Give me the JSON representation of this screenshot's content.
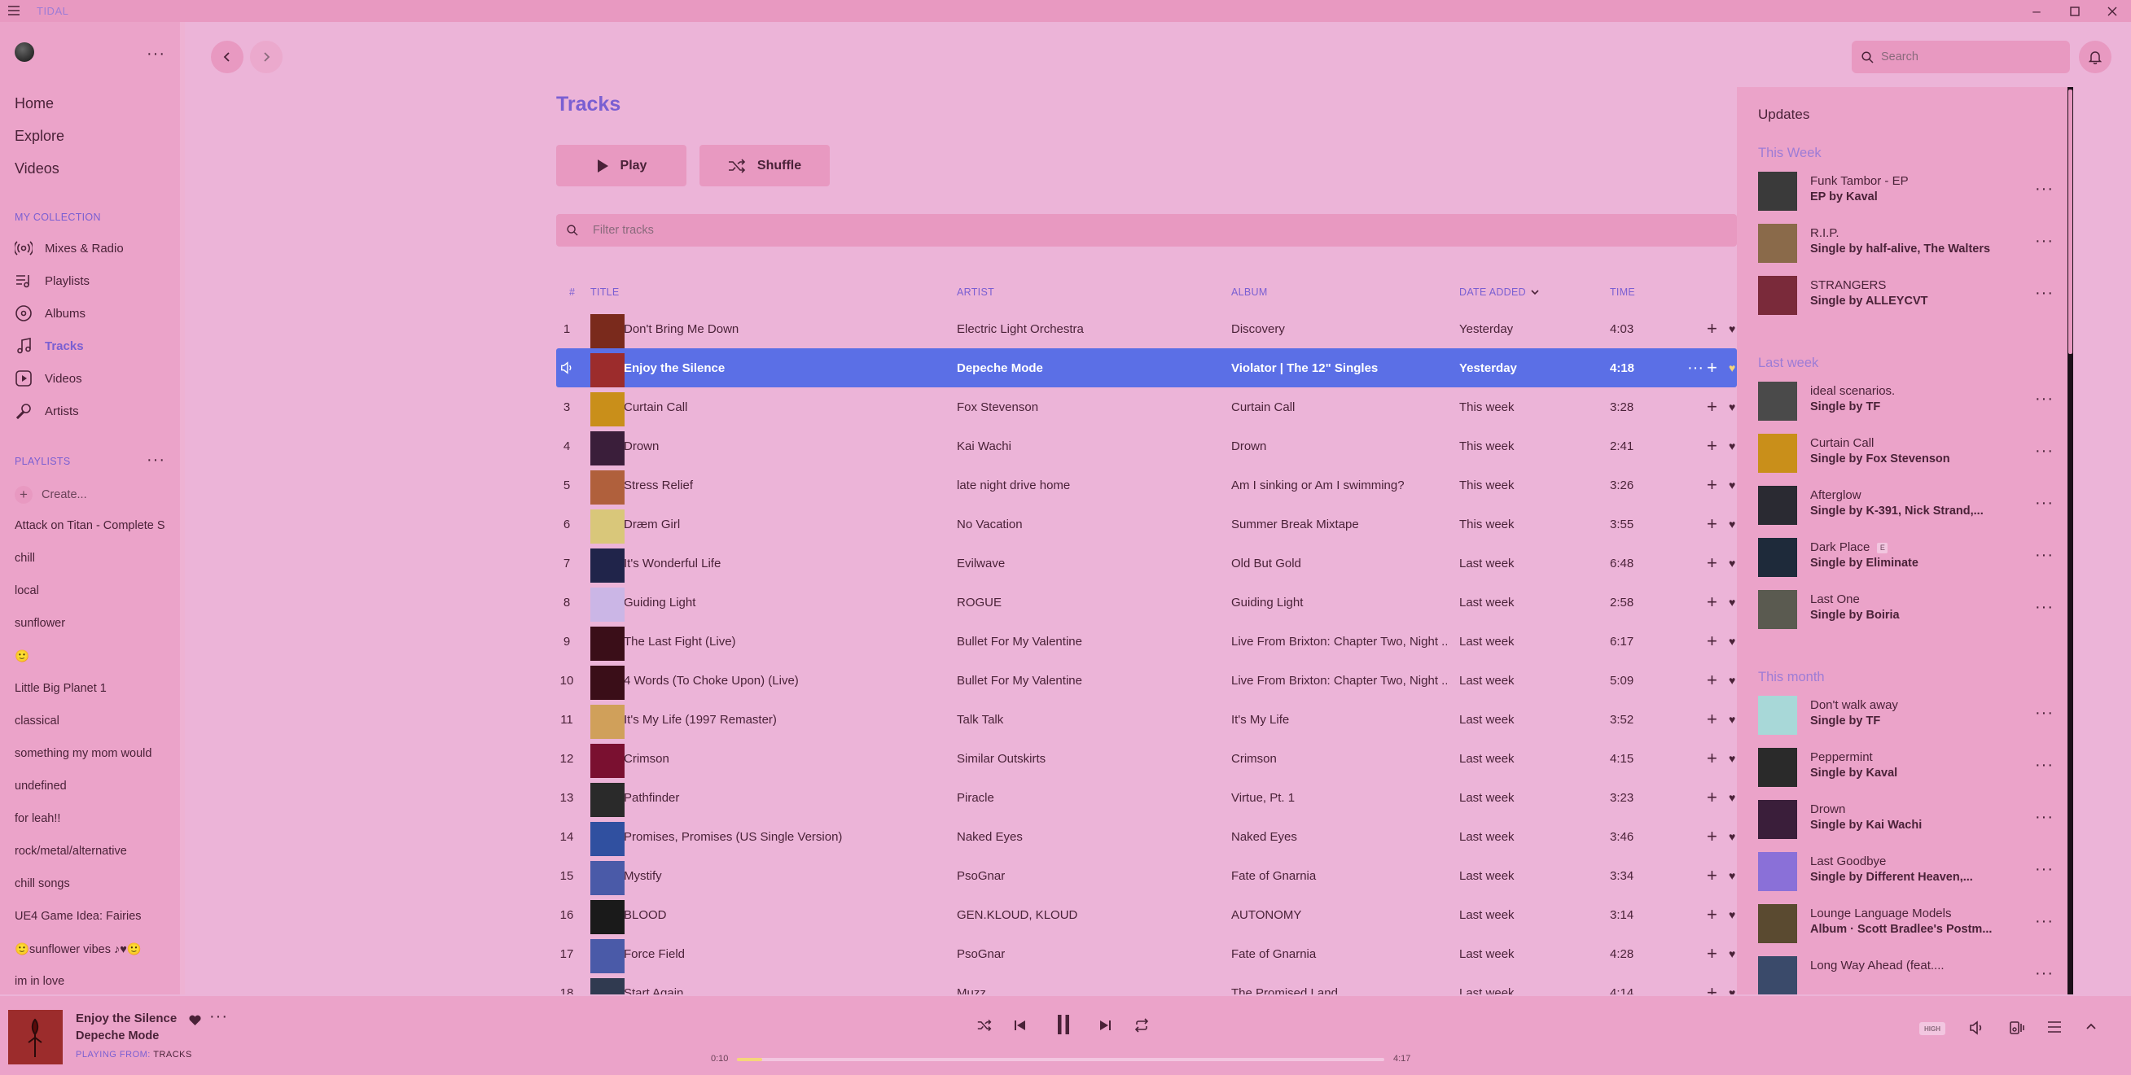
{
  "app": {
    "title": "TIDAL"
  },
  "colors": {
    "accent": "#7a5fd2",
    "selected_row": "#5b6fe6",
    "background": "#ecb4d8",
    "panel": "#eba3c9"
  },
  "sidebar": {
    "nav": [
      "Home",
      "Explore",
      "Videos"
    ],
    "collection_header": "MY COLLECTION",
    "collection": [
      {
        "label": "Mixes & Radio",
        "icon": "radio-icon"
      },
      {
        "label": "Playlists",
        "icon": "playlist-icon"
      },
      {
        "label": "Albums",
        "icon": "album-icon"
      },
      {
        "label": "Tracks",
        "icon": "music-note-icon",
        "active": true
      },
      {
        "label": "Videos",
        "icon": "video-icon"
      },
      {
        "label": "Artists",
        "icon": "microphone-icon"
      }
    ],
    "playlists_header": "PLAYLISTS",
    "create_label": "Create...",
    "playlists": [
      "Attack on Titan - Complete S",
      "chill",
      "local",
      "sunflower",
      "🙂",
      "Little Big Planet 1",
      "classical",
      "something my mom would",
      "undefined",
      "for leah!!",
      "rock/metal/alternative",
      "chill songs",
      "UE4 Game Idea: Fairies",
      "🙂sunflower vibes ♪♥🙂",
      "im in love"
    ]
  },
  "header": {
    "search_placeholder": "Search"
  },
  "main": {
    "title": "Tracks",
    "play_label": "Play",
    "shuffle_label": "Shuffle",
    "filter_placeholder": "Filter tracks",
    "columns": {
      "num": "#",
      "title": "TITLE",
      "artist": "ARTIST",
      "album": "ALBUM",
      "date": "DATE ADDED",
      "time": "TIME"
    },
    "tracks": [
      {
        "n": "1",
        "title": "Don't Bring Me Down",
        "artist": "Electric Light Orchestra",
        "album": "Discovery",
        "date": "Yesterday",
        "time": "4:03",
        "color": "#7a2a1c"
      },
      {
        "n": "2",
        "title": "Enjoy the Silence",
        "artist": "Depeche Mode",
        "album": "Violator | The 12\" Singles",
        "date": "Yesterday",
        "time": "4:18",
        "color": "#9c2c2c",
        "selected": true
      },
      {
        "n": "3",
        "title": "Curtain Call",
        "artist": "Fox Stevenson",
        "album": "Curtain Call",
        "date": "This week",
        "time": "3:28",
        "color": "#c98f1a"
      },
      {
        "n": "4",
        "title": "Drown",
        "artist": "Kai Wachi",
        "album": "Drown",
        "date": "This week",
        "time": "2:41",
        "color": "#3a1e3a"
      },
      {
        "n": "5",
        "title": "Stress Relief",
        "artist": "late night drive home",
        "album": "Am I sinking or Am I swimming?",
        "date": "This week",
        "time": "3:26",
        "color": "#b0603c"
      },
      {
        "n": "6",
        "title": "Dræm Girl",
        "artist": "No Vacation",
        "album": "Summer Break Mixtape",
        "date": "This week",
        "time": "3:55",
        "color": "#d9c77a"
      },
      {
        "n": "7",
        "title": "It's Wonderful Life",
        "artist": "Evilwave",
        "album": "Old But Gold",
        "date": "Last week",
        "time": "6:48",
        "color": "#20244a"
      },
      {
        "n": "8",
        "title": "Guiding Light",
        "artist": "ROGUE",
        "album": "Guiding Light",
        "date": "Last week",
        "time": "2:58",
        "color": "#cbb6e6"
      },
      {
        "n": "9",
        "title": "The Last Fight (Live)",
        "artist": "Bullet For My Valentine",
        "album": "Live From Brixton: Chapter Two, Night ...",
        "date": "Last week",
        "time": "6:17",
        "color": "#3a0e18"
      },
      {
        "n": "10",
        "title": "4 Words (To Choke Upon) (Live)",
        "artist": "Bullet For My Valentine",
        "album": "Live From Brixton: Chapter Two, Night ...",
        "date": "Last week",
        "time": "5:09",
        "color": "#3a0e18"
      },
      {
        "n": "11",
        "title": "It's My Life (1997 Remaster)",
        "artist": "Talk Talk",
        "album": "It's My Life",
        "date": "Last week",
        "time": "3:52",
        "color": "#d0a05a"
      },
      {
        "n": "12",
        "title": "Crimson",
        "artist": "Similar Outskirts",
        "album": "Crimson",
        "date": "Last week",
        "time": "4:15",
        "color": "#7a1030"
      },
      {
        "n": "13",
        "title": "Pathfinder",
        "artist": "Piracle",
        "album": "Virtue, Pt. 1",
        "date": "Last week",
        "time": "3:23",
        "color": "#2a2a2a"
      },
      {
        "n": "14",
        "title": "Promises, Promises (US Single Version)",
        "artist": "Naked Eyes",
        "album": "Naked Eyes",
        "date": "Last week",
        "time": "3:46",
        "color": "#3050a0"
      },
      {
        "n": "15",
        "title": "Mystify",
        "artist": "PsoGnar",
        "album": "Fate of Gnarnia",
        "date": "Last week",
        "time": "3:34",
        "color": "#4a5aa8"
      },
      {
        "n": "16",
        "title": "BLOOD",
        "artist": "GEN.KLOUD, KLOUD",
        "album": "AUTONOMY",
        "date": "Last week",
        "time": "3:14",
        "color": "#1a1a1a"
      },
      {
        "n": "17",
        "title": "Force Field",
        "artist": "PsoGnar",
        "album": "Fate of Gnarnia",
        "date": "Last week",
        "time": "4:28",
        "color": "#4a5aa8"
      },
      {
        "n": "18",
        "title": "Start Again",
        "artist": "Muzz",
        "album": "The Promised Land",
        "date": "Last week",
        "time": "4:14",
        "color": "#303a50"
      }
    ]
  },
  "updates": {
    "title": "Updates",
    "sections": [
      {
        "label": "This Week",
        "items": [
          {
            "title": "Funk Tambor - EP",
            "sub": "EP by Kaval",
            "color": "#3a3a3a"
          },
          {
            "title": "R.I.P.",
            "sub": "Single by half-alive, The Walters",
            "color": "#8a6a4a"
          },
          {
            "title": "STRANGERS",
            "sub": "Single by ALLEYCVT",
            "color": "#7a2a3a"
          }
        ]
      },
      {
        "label": "Last week",
        "items": [
          {
            "title": "ideal scenarios.",
            "sub": "Single by TF",
            "color": "#4a4a4a"
          },
          {
            "title": "Curtain Call",
            "sub": "Single by Fox Stevenson",
            "color": "#c98f1a"
          },
          {
            "title": "Afterglow",
            "sub": "Single by K-391, Nick Strand,...",
            "color": "#2a2a32"
          },
          {
            "title": "Dark Place",
            "sub": "Single by Eliminate",
            "color": "#1e2a3a",
            "explicit": "E"
          },
          {
            "title": "Last One",
            "sub": "Single by Boiria",
            "color": "#5a5a50"
          }
        ]
      },
      {
        "label": "This month",
        "items": [
          {
            "title": "Don't walk away",
            "sub": "Single by TF",
            "color": "#a8d8d8"
          },
          {
            "title": "Peppermint",
            "sub": "Single by Kaval",
            "color": "#2a2a2a"
          },
          {
            "title": "Drown",
            "sub": "Single by Kai Wachi",
            "color": "#3a1e3a"
          },
          {
            "title": "Last Goodbye",
            "sub": "Single by Different Heaven,...",
            "color": "#8a70d8"
          },
          {
            "title": "Lounge Language Models",
            "sub": "Album · Scott Bradlee's Postm...",
            "color": "#5a4a30"
          },
          {
            "title": "Long Way Ahead (feat....",
            "sub": "",
            "color": "#3a4a6a"
          }
        ]
      }
    ]
  },
  "player": {
    "title": "Enjoy the Silence",
    "artist": "Depeche Mode",
    "playing_from_label": "PLAYING FROM:",
    "playing_from": "TRACKS",
    "elapsed": "0:10",
    "duration": "4:17",
    "progress": 0.039,
    "quality": "HIGH"
  }
}
